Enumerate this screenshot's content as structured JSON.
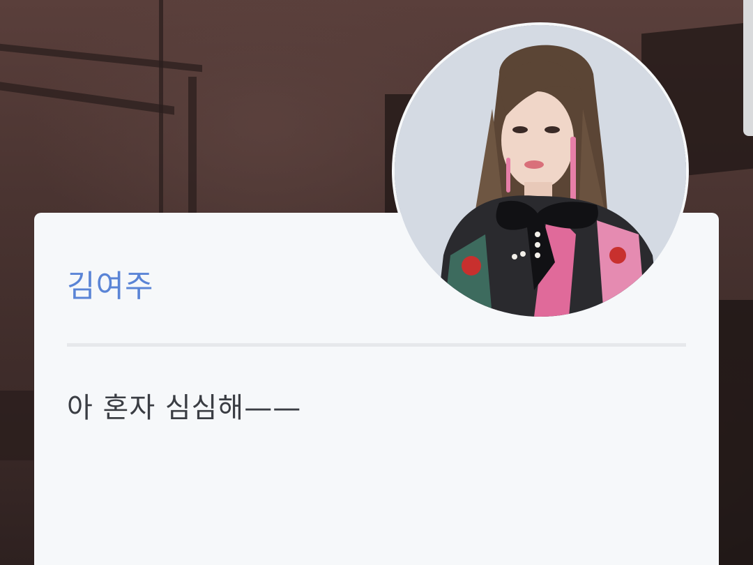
{
  "profile": {
    "name": "김여주",
    "name_color": "#5a84d6",
    "avatar_icon": "portrait-photo"
  },
  "message": {
    "text": "아 혼자 심심해——"
  },
  "colors": {
    "card_background": "#f6f8fa",
    "divider": "#e6e8eb",
    "message_text": "#3a3d43"
  }
}
